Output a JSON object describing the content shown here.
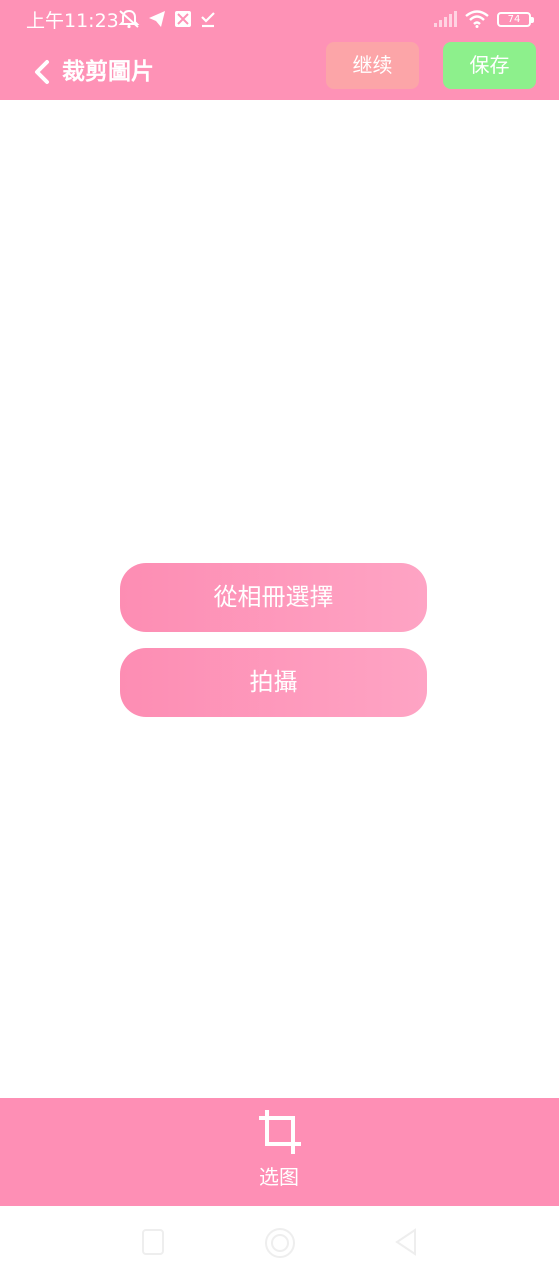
{
  "status_bar": {
    "time": "上午11:23",
    "battery_level": "74",
    "icons_left": [
      "mute-bell-icon",
      "telegram-send-icon",
      "app-notification-icon",
      "download-done-icon"
    ],
    "icons_right": [
      "signal-icon",
      "wifi-icon",
      "battery-icon"
    ]
  },
  "app_bar": {
    "title": "裁剪圖片",
    "continue_label": "继续",
    "save_label": "保存"
  },
  "main": {
    "album_button_label": "從相冊選擇",
    "camera_button_label": "拍攝"
  },
  "bottom_bar": {
    "crop_tab_label": "选图",
    "crop_tab_icon": "crop-icon"
  },
  "nav_bar": {
    "icons": [
      "recents-icon",
      "home-icon",
      "back-triangle-icon"
    ]
  },
  "colors": {
    "header_pink": "#fe92b6",
    "continue_button": "#fca5a8",
    "save_button": "#8df08c",
    "action_button_start": "#fd8db3",
    "action_button_end": "#fea4c4",
    "bottom_bar_pink": "#fe8fb5"
  }
}
